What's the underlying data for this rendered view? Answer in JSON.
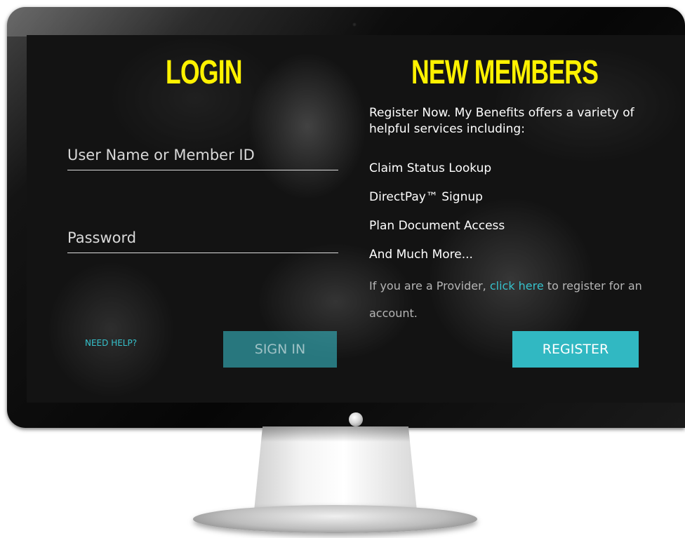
{
  "login": {
    "title": "LOGIN",
    "username_placeholder": "User Name or Member ID",
    "password_placeholder": "Password",
    "need_help_label": "NEED HELP?",
    "sign_in_label": "SIGN IN"
  },
  "new_members": {
    "title": "NEW MEMBERS",
    "intro": "Register Now. My Benefits offers a variety of helpful services including:",
    "benefits": [
      "Claim Status Lookup",
      "DirectPay™ Signup",
      "Plan Document Access",
      "And Much More..."
    ],
    "provider_prefix": "If you are a Provider, ",
    "provider_link": "click here",
    "provider_suffix": " to register for an account.",
    "register_label": "REGISTER"
  },
  "colors": {
    "heading": "#fff200",
    "accent": "#31b8c2",
    "text": "#ffffff",
    "muted_text": "#b5b5b5"
  }
}
